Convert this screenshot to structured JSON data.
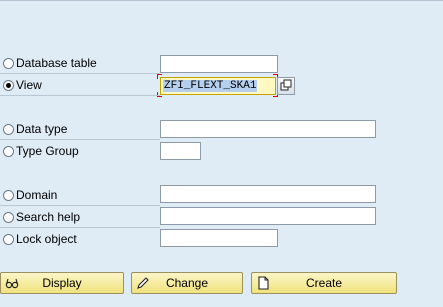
{
  "object_types": [
    {
      "label": "Database table",
      "selected": false,
      "value": ""
    },
    {
      "label": "View",
      "selected": true,
      "value": "ZFI_FLEXT_SKA1"
    },
    {
      "label": "Data type",
      "selected": false,
      "value": ""
    },
    {
      "label": "Type Group",
      "selected": false,
      "value": ""
    },
    {
      "label": "Domain",
      "selected": false,
      "value": ""
    },
    {
      "label": "Search help",
      "selected": false,
      "value": ""
    },
    {
      "label": "Lock object",
      "selected": false,
      "value": ""
    }
  ],
  "buttons": {
    "display": "Display",
    "change": "Change",
    "create": "Create"
  },
  "icons": {
    "display": "glasses-icon",
    "change": "pencil-icon",
    "create": "new-document-icon",
    "value_help": "value-help-icon"
  },
  "colors": {
    "background": "#dfebf5",
    "button_fill": "#f0e27c",
    "active_field": "#fff8c2",
    "focus_marker": "#e00000"
  }
}
